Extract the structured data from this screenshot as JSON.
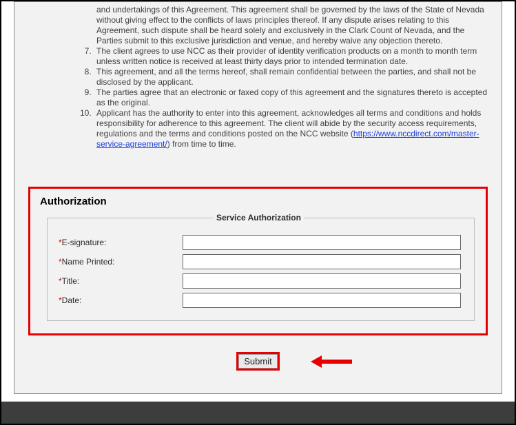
{
  "terms": {
    "start": 7,
    "item6_tail": "and undertakings of this Agreement. This agreement shall be governed by the laws of the State of Nevada without giving effect to the conflicts of laws principles thereof. If any dispute arises relating to this Agreement, such dispute shall be heard solely and exclusively in the Clark Count of Nevada, and the Parties submit to this exclusive jurisdiction and venue, and hereby waive any objection thereto.",
    "item7": " The client agrees to use NCC as their provider of identity verification products on a month to month term unless written notice is received at least thirty days prior to intended termination date.",
    "item8": " This agreement, and all the terms hereof, shall remain confidential between the parties, and shall not be disclosed by the applicant.",
    "item9": " The parties agree that an electronic or faxed copy of this agreement and the signatures thereto is accepted as the original.",
    "item10_a": " Applicant has the authority to enter into this agreement, acknowledges all terms and conditions and holds responsibility for adherence to this agreement. The client will abide by the security access requirements, regulations and the terms and conditions posted on the NCC website (",
    "item10_link": "https://www.nccdirect.com/master-service-agreement/",
    "item10_b": ") from time to time."
  },
  "authorization": {
    "heading": "Authorization",
    "legend": "Service Authorization",
    "fields": {
      "esignature": {
        "label": "E-signature:",
        "value": ""
      },
      "name_printed": {
        "label": "Name Printed:",
        "value": ""
      },
      "title": {
        "label": "Title:",
        "value": ""
      },
      "date": {
        "label": "Date:",
        "value": ""
      }
    }
  },
  "submit_label": "Submit"
}
